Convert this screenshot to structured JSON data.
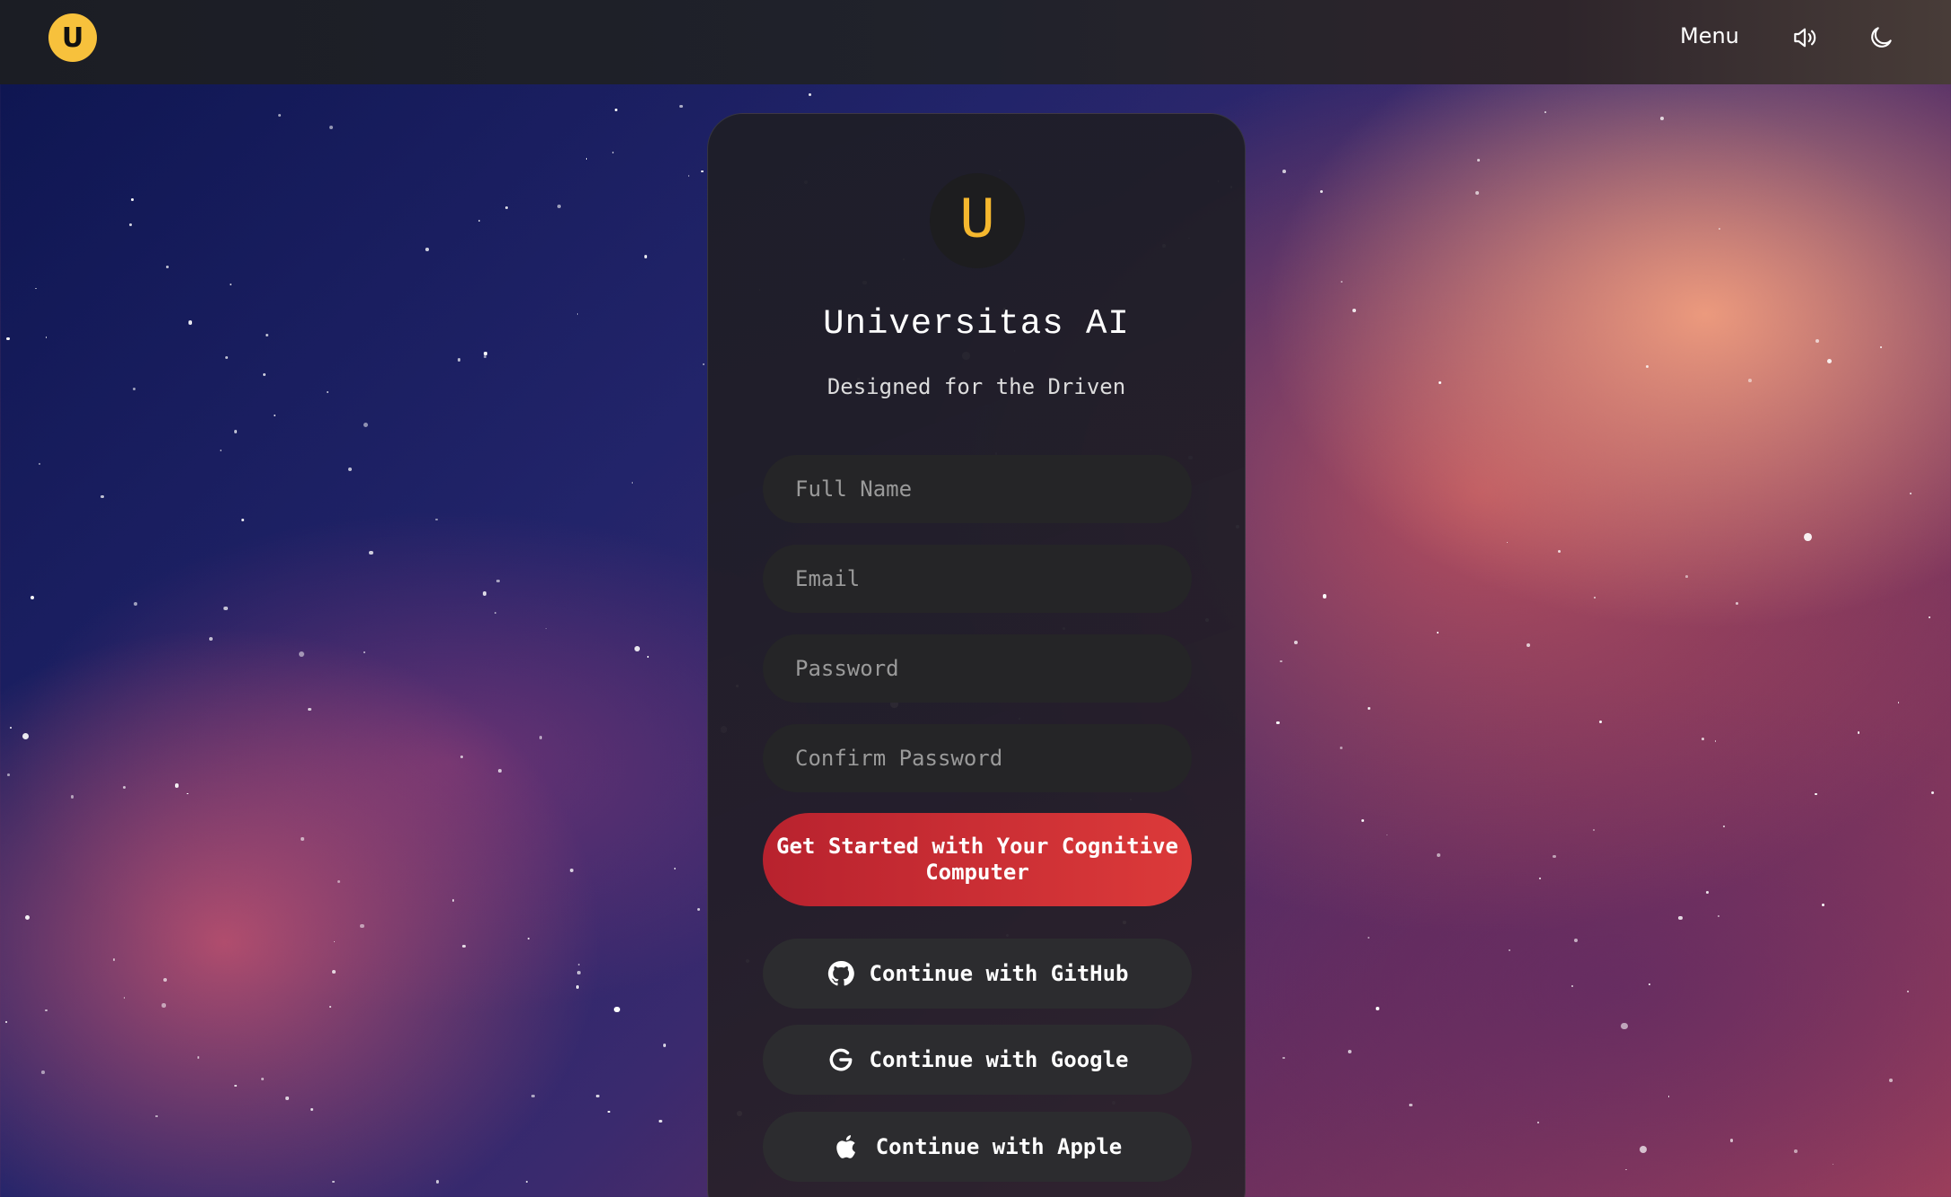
{
  "header": {
    "logo_letter": "U",
    "menu_label": "Menu",
    "icons": [
      "speaker-icon",
      "moon-icon"
    ]
  },
  "card": {
    "logo_letter": "U",
    "title": "Universitas AI",
    "subtitle": "Designed for the Driven",
    "fields": [
      {
        "placeholder": "Full Name",
        "value": ""
      },
      {
        "placeholder": "Email",
        "value": ""
      },
      {
        "placeholder": "Password",
        "value": ""
      },
      {
        "placeholder": "Confirm Password",
        "value": ""
      }
    ],
    "primary_button": "Get Started with Your Cognitive Computer",
    "oauth": [
      {
        "label": "Continue with GitHub",
        "icon": "github-icon"
      },
      {
        "label": "Continue with Google",
        "icon": "google-icon"
      },
      {
        "label": "Continue with Apple",
        "icon": "apple-icon"
      }
    ]
  },
  "colors": {
    "accent": "#f7c13c",
    "primary_button": "#d23333"
  }
}
